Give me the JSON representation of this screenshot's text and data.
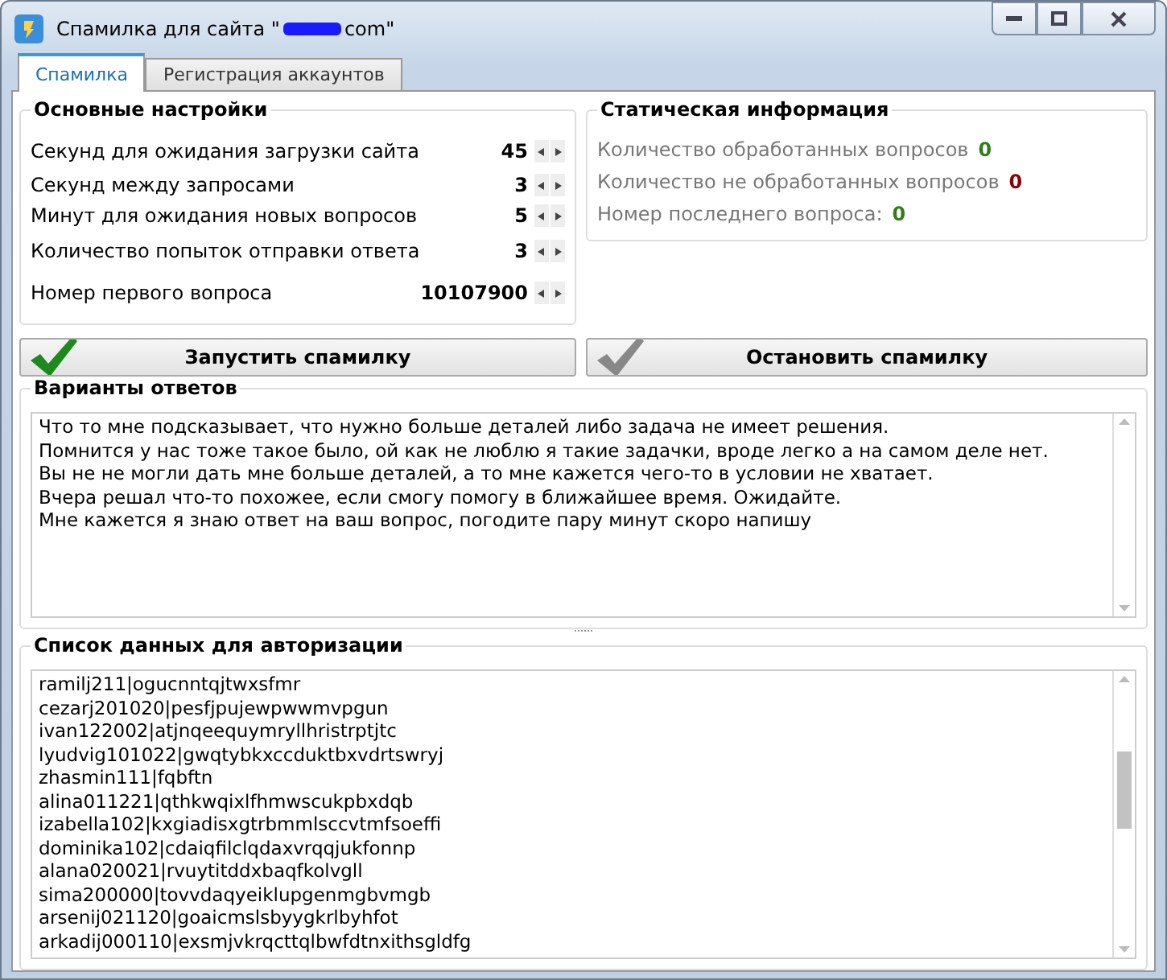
{
  "window": {
    "title_start": "Спамилка для сайта \"",
    "title_end": "com\""
  },
  "tabs": [
    {
      "label": "Спамилка",
      "selected": true
    },
    {
      "label": "Регистрация аккаунтов",
      "selected": false
    }
  ],
  "settings": {
    "title": "Основные настройки",
    "rows": [
      {
        "label": "Секунд для ожидания загрузки сайта",
        "value": "45"
      },
      {
        "label": "Секунд между запросами",
        "value": "3"
      },
      {
        "label": "Минут для ожидания новых вопросов",
        "value": "5"
      },
      {
        "label": "Количество попыток отправки ответа",
        "value": "3"
      },
      {
        "label": "Номер первого вопроса",
        "value": "10107900"
      }
    ]
  },
  "stats": {
    "title": "Статическая информация",
    "rows": [
      {
        "label": "Количество обработанных вопросов",
        "value": "0",
        "color": "#2e7d1a"
      },
      {
        "label": "Количество не обработанных вопросов",
        "value": "0",
        "color": "#8b0000"
      },
      {
        "label": "Номер последнего вопроса:",
        "value": "0",
        "color": "#2e7d1a"
      }
    ]
  },
  "buttons": [
    {
      "label": "Запустить спамилку",
      "active": true
    },
    {
      "label": "Остановить спамилку",
      "active": false
    }
  ],
  "answers": {
    "title": "Варианты ответов",
    "lines": [
      "Что то мне подсказывает, что нужно больше деталей либо задача не имеет решения.",
      "Помнится у нас тоже такое было, ой как не люблю я такие задачки, вроде легко а на самом деле нет.",
      "Вы не не могли дать мне больше деталей, а то мне кажется чего-то в условии не хватает.",
      "Вчера решал что-то похожее, если смогу помогу в ближайшее время. Ожидайте.",
      "Мне кажется я знаю ответ на ваш вопрос, погодите пару минут скоро напишу"
    ]
  },
  "auth": {
    "title": "Список данных для авторизации",
    "lines": [
      "ramilj211|ogucnntqjtwxsfmr",
      "cezarj201020|pesfjpujewpwwmvpgun",
      "ivan122002|atjnqeequymryllhristrptjtc",
      "lyudvig101022|gwqtybkxccduktbxvdrtswryj",
      "zhasmin111|fqbftn",
      "alina011221|qthkwqixlfhmwscukpbxdqb",
      "izabella102|kxgiadisxgtrbmmlsccvtmfsoeffi",
      "dominika102|cdaiqfilclqdaxvrqqjukfonnp",
      "alana020021|rvuytitddxbaqfkolvgll",
      "sima200000|tovvdaqyeiklupgenmgbvmgb",
      "arsenij021120|goaicmslsbyygkrlbyhfot",
      "arkadij000110|exsmjvkrqcttqlbwfdtnxithsgldfg"
    ]
  }
}
